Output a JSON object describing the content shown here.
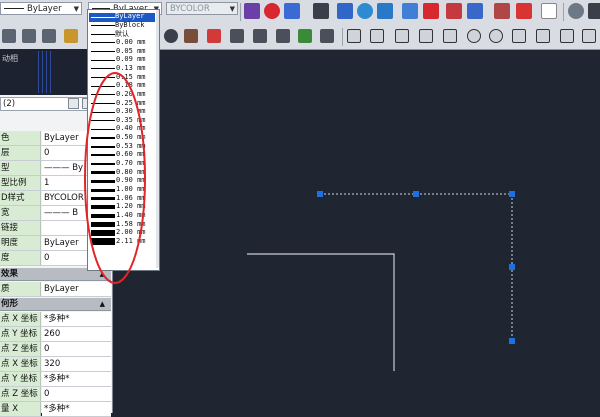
{
  "top_toolbar": {
    "layer_combo": "ByLayer",
    "lineweight_combo": "ByLayer",
    "color_combo": "BYCOLOR"
  },
  "left_strip": {
    "label": "动相"
  },
  "properties": {
    "header": "(2)",
    "rows": [
      {
        "label": "色",
        "value": "ByLayer"
      },
      {
        "label": "层",
        "value": "0"
      },
      {
        "label": "型",
        "value": "——— By"
      },
      {
        "label": "型比例",
        "value": "1"
      },
      {
        "label": "D样式",
        "value": "BYCOLOR"
      },
      {
        "label": "宽",
        "value": "——— B"
      },
      {
        "label": "链接",
        "value": ""
      },
      {
        "label": "明度",
        "value": "ByLayer"
      },
      {
        "label": "度",
        "value": "0"
      }
    ],
    "section_3d": "效果",
    "row_material": {
      "label": "质",
      "value": "ByLayer"
    },
    "section_geometry": "何形",
    "geo_rows": [
      {
        "label": "点 X 坐标",
        "value": "*多种*"
      },
      {
        "label": "点 Y 坐标",
        "value": "260"
      },
      {
        "label": "点 Z 坐标",
        "value": "0"
      },
      {
        "label": "点 X 坐标",
        "value": "320"
      },
      {
        "label": "点 Y 坐标",
        "value": "*多种*"
      },
      {
        "label": "点 Z 坐标",
        "value": "0"
      },
      {
        "label": "量 X",
        "value": "*多种*"
      }
    ]
  },
  "lineweight_list": {
    "items": [
      {
        "label": "ByLayer",
        "weight": 0.1,
        "selected": true
      },
      {
        "label": "ByBlock",
        "weight": 0.1
      },
      {
        "label": "默认",
        "weight": 0.1
      },
      {
        "label": "0.00 mm",
        "weight": 0.1
      },
      {
        "label": "0.05 mm",
        "weight": 0.1
      },
      {
        "label": "0.09 mm",
        "weight": 0.1
      },
      {
        "label": "0.13 mm",
        "weight": 0.13
      },
      {
        "label": "0.15 mm",
        "weight": 0.15
      },
      {
        "label": "0.18 mm",
        "weight": 0.18
      },
      {
        "label": "0.20 mm",
        "weight": 0.2
      },
      {
        "label": "0.25 mm",
        "weight": 0.25
      },
      {
        "label": "0.30 mm",
        "weight": 0.3
      },
      {
        "label": "0.35 mm",
        "weight": 0.35
      },
      {
        "label": "0.40 mm",
        "weight": 0.4
      },
      {
        "label": "0.50 mm",
        "weight": 0.5
      },
      {
        "label": "0.53 mm",
        "weight": 0.53
      },
      {
        "label": "0.60 mm",
        "weight": 0.6
      },
      {
        "label": "0.70 mm",
        "weight": 0.7
      },
      {
        "label": "0.80 mm",
        "weight": 0.8
      },
      {
        "label": "0.90 mm",
        "weight": 0.9
      },
      {
        "label": "1.00 mm",
        "weight": 1.0
      },
      {
        "label": "1.06 mm",
        "weight": 1.06
      },
      {
        "label": "1.20 mm",
        "weight": 1.2
      },
      {
        "label": "1.40 mm",
        "weight": 1.4
      },
      {
        "label": "1.58 mm",
        "weight": 1.58
      },
      {
        "label": "2.00 mm",
        "weight": 2.0
      },
      {
        "label": "2.11 mm",
        "weight": 2.11
      }
    ]
  },
  "colors": {
    "canvas_bg": "#1f2632",
    "selection_blue": "#1d59c4",
    "grip_blue": "#1e6fe0",
    "annotation_red": "#e0262a",
    "prop_label_bg": "#d7ecd3"
  }
}
